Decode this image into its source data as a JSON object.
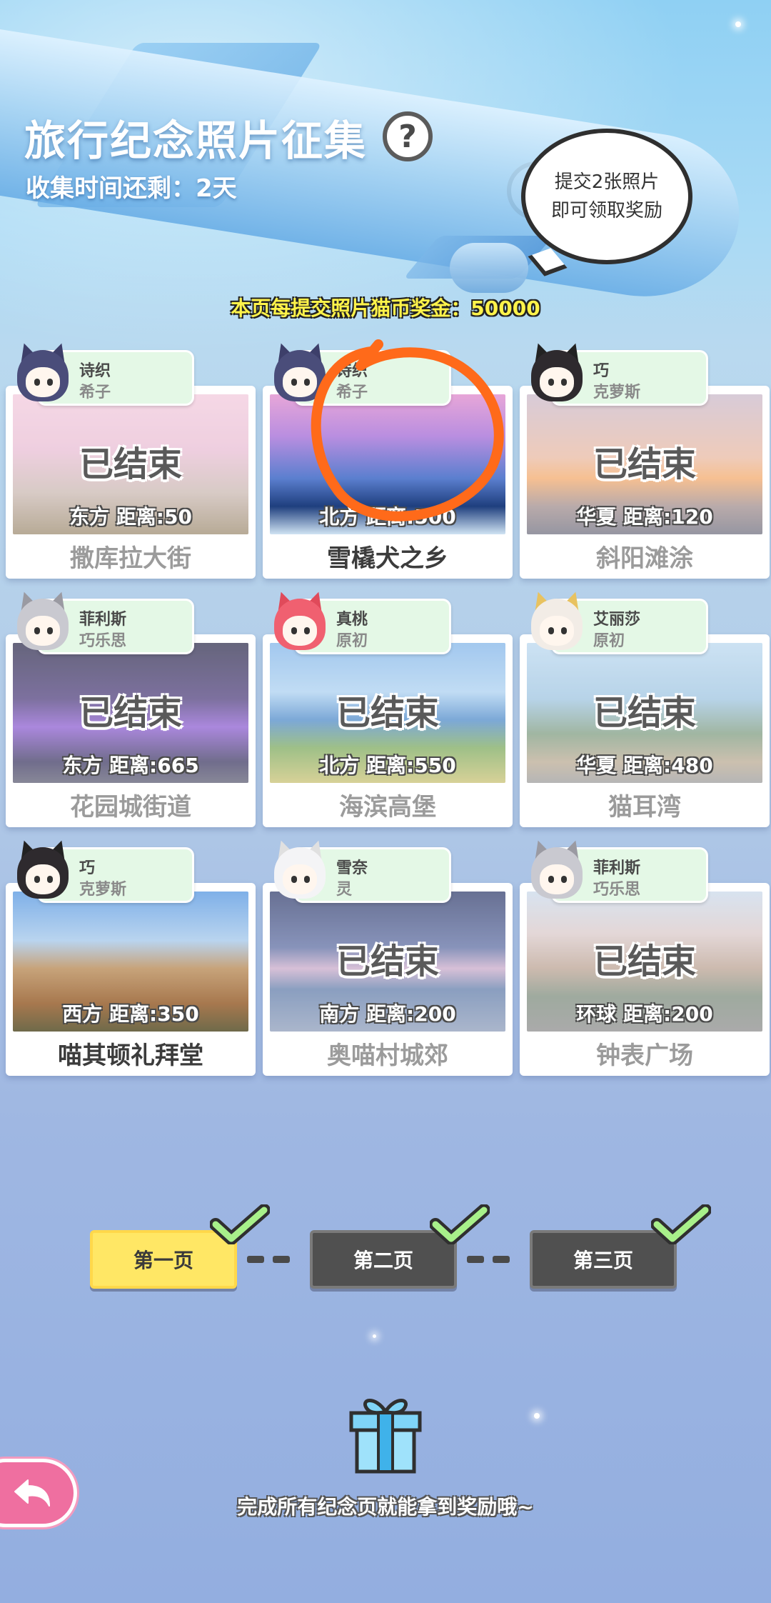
{
  "header": {
    "title": "旅行纪念照片征集",
    "help_label": "?",
    "time_left": "收集时间还剩：2天"
  },
  "bubble": {
    "line1": "提交2张照片",
    "line2": "即可领取奖励"
  },
  "bonus_text": "本页每提交照片猫币奖金：50000",
  "cards": [
    {
      "tag_name": "诗织",
      "tag_sub": "希子",
      "status": "已结束",
      "distance": "东方  距离:50",
      "name": "撒库拉大街"
    },
    {
      "tag_name": "诗织",
      "tag_sub": "希子",
      "status": "",
      "distance": "北方  距离:500",
      "name": "雪橇犬之乡"
    },
    {
      "tag_name": "巧",
      "tag_sub": "克萝斯",
      "status": "已结束",
      "distance": "华夏  距离:120",
      "name": "斜阳滩涂"
    },
    {
      "tag_name": "菲利斯",
      "tag_sub": "巧乐思",
      "status": "已结束",
      "distance": "东方  距离:665",
      "name": "花园城街道"
    },
    {
      "tag_name": "真桃",
      "tag_sub": "原初",
      "status": "已结束",
      "distance": "北方  距离:550",
      "name": "海滨高堡"
    },
    {
      "tag_name": "艾丽莎",
      "tag_sub": "原初",
      "status": "已结束",
      "distance": "华夏  距离:480",
      "name": "猫耳湾"
    },
    {
      "tag_name": "巧",
      "tag_sub": "克萝斯",
      "status": "",
      "distance": "西方  距离:350",
      "name": "喵其顿礼拜堂"
    },
    {
      "tag_name": "雪奈",
      "tag_sub": "灵",
      "status": "已结束",
      "distance": "南方  距离:200",
      "name": "奥喵村城郊"
    },
    {
      "tag_name": "菲利斯",
      "tag_sub": "巧乐思",
      "status": "已结束",
      "distance": "环球  距离:200",
      "name": "钟表广场"
    }
  ],
  "pager": {
    "page1": "第一页",
    "page2": "第二页",
    "page3": "第三页"
  },
  "footer": {
    "reward_text": "完成所有纪念页就能拿到奖励哦~"
  },
  "icons": {
    "help": "question-icon",
    "check": "checkmark-icon",
    "gift": "gift-icon",
    "back": "back-arrow-icon"
  },
  "colors": {
    "active_page": "#ffe765",
    "inactive_page": "#505050",
    "check_green": "#a8f08a",
    "tag_bg": "#e4f8e6",
    "annotation": "#ff6a1a",
    "back_button": "#ef6fa0"
  }
}
